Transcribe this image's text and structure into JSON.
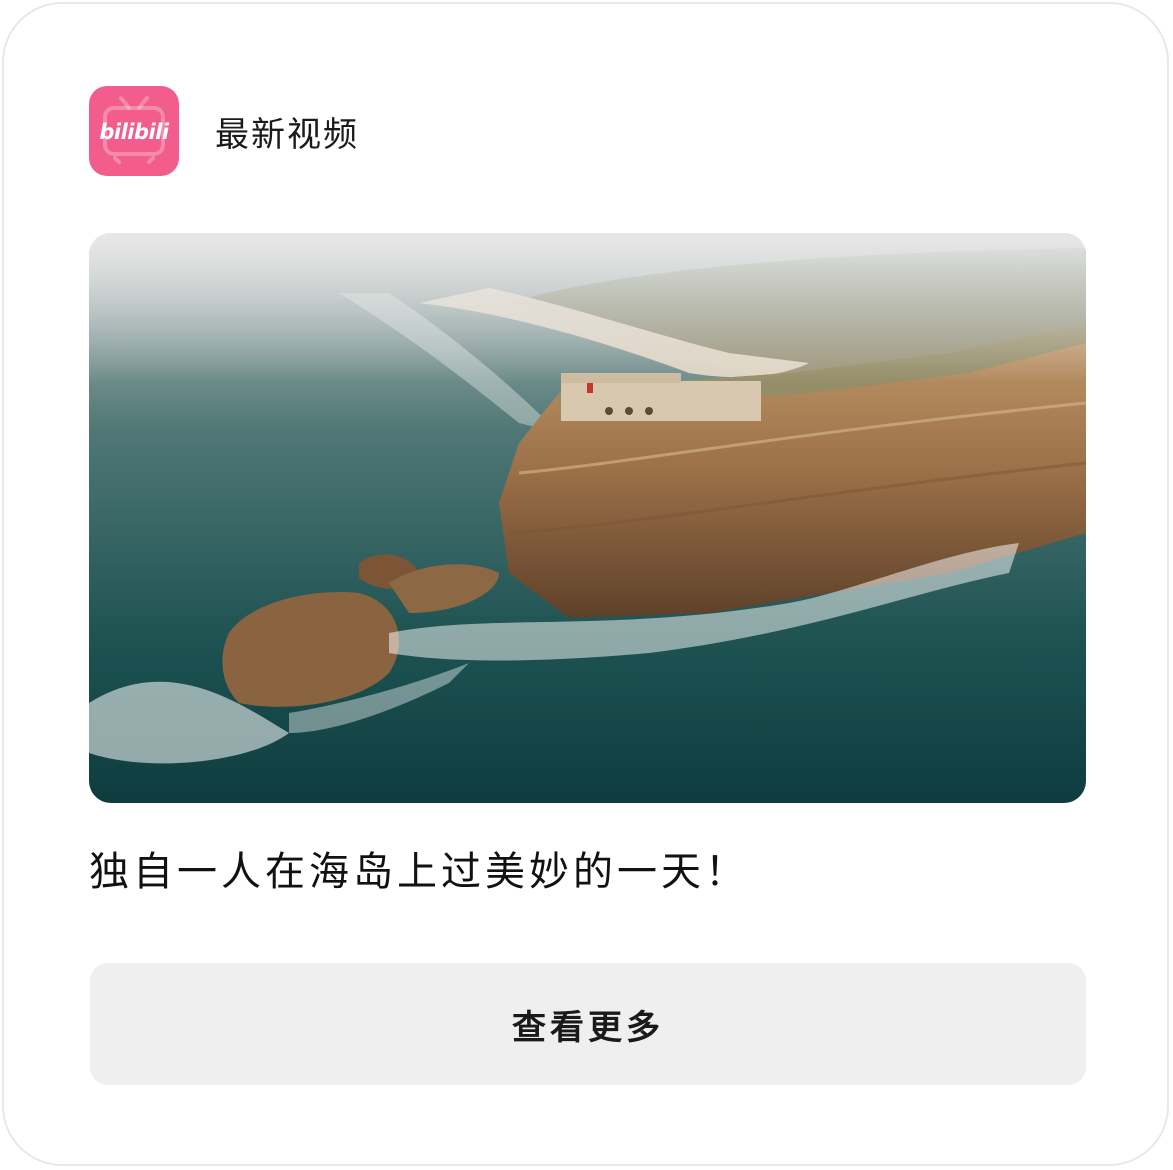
{
  "widget": {
    "app_name": "bilibili",
    "header_title": "最新视频",
    "brand_color": "#f25d8e",
    "icon": "bilibili-tv-icon"
  },
  "video": {
    "thumbnail": "coastal-cliff-lighthouse-photo",
    "title": "独自一人在海岛上过美妙的一天！"
  },
  "actions": {
    "more_label": "查看更多"
  }
}
